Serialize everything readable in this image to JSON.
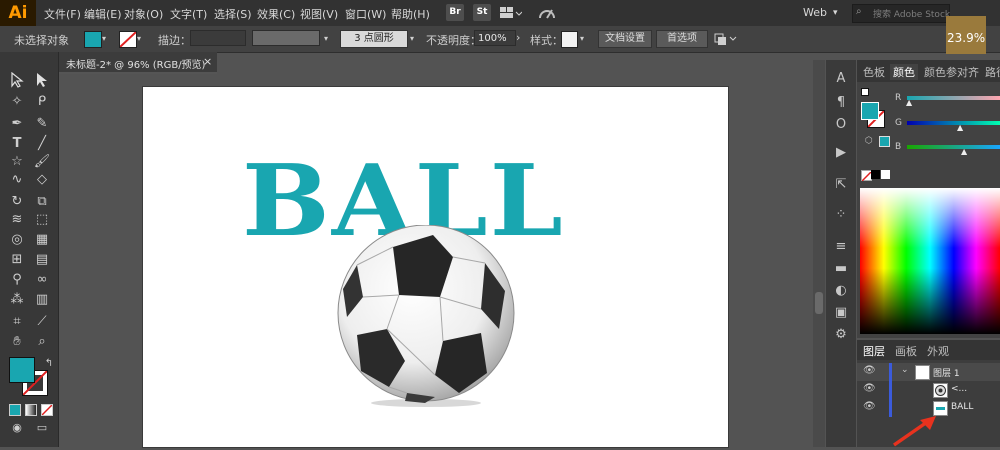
{
  "app": {
    "logo": "Ai"
  },
  "menubar": {
    "items": [
      "文件(F)",
      "编辑(E)",
      "对象(O)",
      "文字(T)",
      "选择(S)",
      "效果(C)",
      "视图(V)",
      "窗口(W)",
      "帮助(H)"
    ],
    "bridge": "Br",
    "stock": "St",
    "workspace": "Web",
    "search_placeholder": "搜索 Adobe Stock",
    "zoom_badge": "23.9%"
  },
  "controlbar": {
    "no_selection": "未选择对象",
    "stroke_label": "描边：",
    "brush_label": "3 点圆形",
    "opacity_label": "不透明度：",
    "opacity_value": "100%",
    "style_label": "样式：",
    "doc_setup": "文档设置",
    "preferences": "首选项"
  },
  "document": {
    "tab_title": "未标题-2* @ 96% (RGB/预览)",
    "close_glyph": "×",
    "artwork_text": "BALL",
    "text_color": "#19a6b0"
  },
  "color_panel": {
    "tabs": [
      "色板",
      "颜色",
      "颜色参",
      "对齐",
      "路径"
    ],
    "active_tab": "颜色",
    "channels": [
      "R",
      "G",
      "B"
    ],
    "fill_color": "#19a6b0"
  },
  "layers_panel": {
    "tabs": [
      "图层",
      "画板",
      "外观"
    ],
    "layers": [
      {
        "name": "图层 1"
      },
      {
        "name": "<..."
      },
      {
        "name": "BALL"
      }
    ]
  },
  "toolbar": {
    "fill_color": "#19a6b0"
  }
}
